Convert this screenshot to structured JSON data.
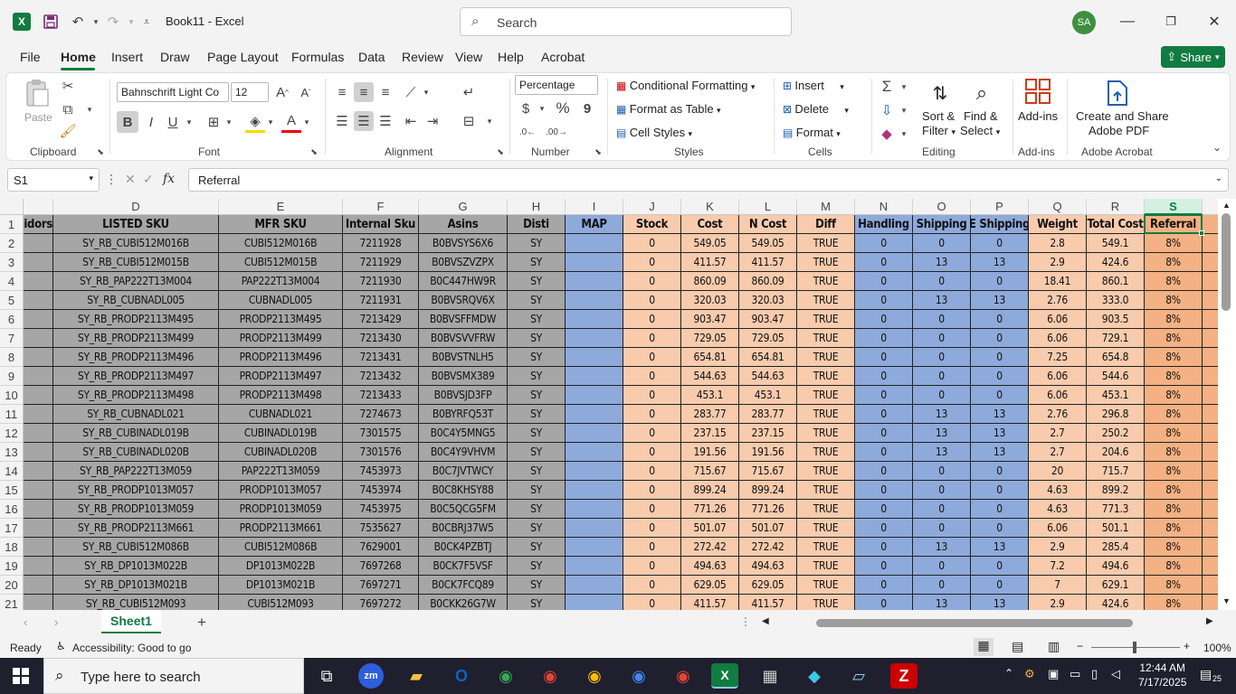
{
  "titlebar": {
    "app_icon": "X",
    "doc_title": "Book11 - Excel",
    "search_placeholder": "Search",
    "user_initials": "SA"
  },
  "tabs": [
    "File",
    "Home",
    "Insert",
    "Draw",
    "Page Layout",
    "Formulas",
    "Data",
    "Review",
    "View",
    "Help",
    "Acrobat"
  ],
  "share_label": "Share",
  "ribbon": {
    "clipboard": {
      "paste": "Paste",
      "label": "Clipboard"
    },
    "font": {
      "name": "Bahnschrift Light Co",
      "size": "12",
      "bold": "B",
      "italic": "I",
      "underline": "U",
      "label": "Font"
    },
    "alignment": {
      "label": "Alignment"
    },
    "number": {
      "format": "Percentage",
      "currency": "$",
      "percent": "%",
      "comma": "9",
      "label": "Number"
    },
    "styles": {
      "cond": "Conditional Formatting",
      "table": "Format as Table",
      "cell": "Cell Styles",
      "label": "Styles"
    },
    "cells": {
      "insert": "Insert",
      "delete": "Delete",
      "format": "Format",
      "label": "Cells"
    },
    "editing": {
      "sort1": "Sort &",
      "sort2": "Filter",
      "find1": "Find &",
      "find2": "Select",
      "label": "Editing"
    },
    "addins": {
      "btn": "Add-ins",
      "label": "Add-ins"
    },
    "acrobat": {
      "btn1": "Create and Share",
      "btn2": "Adobe PDF",
      "label": "Adobe Acrobat"
    }
  },
  "formula_bar": {
    "name_box": "S1",
    "fx": "fx",
    "content": "Referral"
  },
  "columns": [
    {
      "letter": "",
      "header": "idors",
      "color": "gray"
    },
    {
      "letter": "D",
      "header": "LISTED SKU",
      "color": "gray"
    },
    {
      "letter": "E",
      "header": "MFR SKU",
      "color": "gray"
    },
    {
      "letter": "F",
      "header": "Internal Sku",
      "color": "gray"
    },
    {
      "letter": "G",
      "header": "Asins",
      "color": "gray"
    },
    {
      "letter": "H",
      "header": "Disti",
      "color": "gray"
    },
    {
      "letter": "I",
      "header": "MAP",
      "color": "blue"
    },
    {
      "letter": "J",
      "header": "Stock",
      "color": "peach"
    },
    {
      "letter": "K",
      "header": "Cost",
      "color": "peach"
    },
    {
      "letter": "L",
      "header": "N Cost",
      "color": "peach"
    },
    {
      "letter": "M",
      "header": "Diff",
      "color": "peach"
    },
    {
      "letter": "N",
      "header": "Handling",
      "color": "blue"
    },
    {
      "letter": "O",
      "header": "Shipping",
      "color": "blue"
    },
    {
      "letter": "P",
      "header": "E Shipping",
      "color": "blue"
    },
    {
      "letter": "Q",
      "header": "Weight",
      "color": "peach"
    },
    {
      "letter": "R",
      "header": "Total Cost",
      "color": "peach"
    },
    {
      "letter": "S",
      "header": "Referral",
      "color": "orange"
    },
    {
      "letter": "",
      "header": "",
      "color": "orange"
    }
  ],
  "rows": [
    [
      "",
      "SY_RB_CUBI512M016B",
      "CUBI512M016B",
      "7211928",
      "B0BVSYS6X6",
      "SY",
      "",
      "0",
      "549.05",
      "549.05",
      "TRUE",
      "0",
      "0",
      "0",
      "2.8",
      "549.1",
      "8%",
      ""
    ],
    [
      "",
      "SY_RB_CUBI512M015B",
      "CUBI512M015B",
      "7211929",
      "B0BVSZVZPX",
      "SY",
      "",
      "0",
      "411.57",
      "411.57",
      "TRUE",
      "0",
      "13",
      "13",
      "2.9",
      "424.6",
      "8%",
      ""
    ],
    [
      "",
      "SY_RB_PAP222T13M004",
      "PAP222T13M004",
      "7211930",
      "B0C447HW9R",
      "SY",
      "",
      "0",
      "860.09",
      "860.09",
      "TRUE",
      "0",
      "0",
      "0",
      "18.41",
      "860.1",
      "8%",
      ""
    ],
    [
      "",
      "SY_RB_CUBNADL005",
      "CUBNADL005",
      "7211931",
      "B0BVSRQV6X",
      "SY",
      "",
      "0",
      "320.03",
      "320.03",
      "TRUE",
      "0",
      "13",
      "13",
      "2.76",
      "333.0",
      "8%",
      ""
    ],
    [
      "",
      "SY_RB_PRODP2113M495",
      "PRODP2113M495",
      "7213429",
      "B0BVSFFMDW",
      "SY",
      "",
      "0",
      "903.47",
      "903.47",
      "TRUE",
      "0",
      "0",
      "0",
      "6.06",
      "903.5",
      "8%",
      ""
    ],
    [
      "",
      "SY_RB_PRODP2113M499",
      "PRODP2113M499",
      "7213430",
      "B0BVSVVFRW",
      "SY",
      "",
      "0",
      "729.05",
      "729.05",
      "TRUE",
      "0",
      "0",
      "0",
      "6.06",
      "729.1",
      "8%",
      ""
    ],
    [
      "",
      "SY_RB_PRODP2113M496",
      "PRODP2113M496",
      "7213431",
      "B0BVSTNLH5",
      "SY",
      "",
      "0",
      "654.81",
      "654.81",
      "TRUE",
      "0",
      "0",
      "0",
      "7.25",
      "654.8",
      "8%",
      ""
    ],
    [
      "",
      "SY_RB_PRODP2113M497",
      "PRODP2113M497",
      "7213432",
      "B0BVSMX389",
      "SY",
      "",
      "0",
      "544.63",
      "544.63",
      "TRUE",
      "0",
      "0",
      "0",
      "6.06",
      "544.6",
      "8%",
      ""
    ],
    [
      "",
      "SY_RB_PRODP2113M498",
      "PRODP2113M498",
      "7213433",
      "B0BVSJD3FP",
      "SY",
      "",
      "0",
      "453.1",
      "453.1",
      "TRUE",
      "0",
      "0",
      "0",
      "6.06",
      "453.1",
      "8%",
      ""
    ],
    [
      "",
      "SY_RB_CUBNADL021",
      "CUBNADL021",
      "7274673",
      "B0BYRFQ53T",
      "SY",
      "",
      "0",
      "283.77",
      "283.77",
      "TRUE",
      "0",
      "13",
      "13",
      "2.76",
      "296.8",
      "8%",
      ""
    ],
    [
      "",
      "SY_RB_CUBINADL019B",
      "CUBINADL019B",
      "7301575",
      "B0C4Y5MNG5",
      "SY",
      "",
      "0",
      "237.15",
      "237.15",
      "TRUE",
      "0",
      "13",
      "13",
      "2.7",
      "250.2",
      "8%",
      ""
    ],
    [
      "",
      "SY_RB_CUBINADL020B",
      "CUBINADL020B",
      "7301576",
      "B0C4Y9VHVM",
      "SY",
      "",
      "0",
      "191.56",
      "191.56",
      "TRUE",
      "0",
      "13",
      "13",
      "2.7",
      "204.6",
      "8%",
      ""
    ],
    [
      "",
      "SY_RB_PAP222T13M059",
      "PAP222T13M059",
      "7453973",
      "B0C7JVTWCY",
      "SY",
      "",
      "0",
      "715.67",
      "715.67",
      "TRUE",
      "0",
      "0",
      "0",
      "20",
      "715.7",
      "8%",
      ""
    ],
    [
      "",
      "SY_RB_PRODP1013M057",
      "PRODP1013M057",
      "7453974",
      "B0C8KHSY88",
      "SY",
      "",
      "0",
      "899.24",
      "899.24",
      "TRUE",
      "0",
      "0",
      "0",
      "4.63",
      "899.2",
      "8%",
      ""
    ],
    [
      "",
      "SY_RB_PRODP1013M059",
      "PRODP1013M059",
      "7453975",
      "B0C5QCG5FM",
      "SY",
      "",
      "0",
      "771.26",
      "771.26",
      "TRUE",
      "0",
      "0",
      "0",
      "4.63",
      "771.3",
      "8%",
      ""
    ],
    [
      "",
      "SY_RB_PRODP2113M661",
      "PRODP2113M661",
      "7535627",
      "B0CBRJ37W5",
      "SY",
      "",
      "0",
      "501.07",
      "501.07",
      "TRUE",
      "0",
      "0",
      "0",
      "6.06",
      "501.1",
      "8%",
      ""
    ],
    [
      "",
      "SY_RB_CUBI512M086B",
      "CUBI512M086B",
      "7629001",
      "B0CK4PZBTJ",
      "SY",
      "",
      "0",
      "272.42",
      "272.42",
      "TRUE",
      "0",
      "13",
      "13",
      "2.9",
      "285.4",
      "8%",
      ""
    ],
    [
      "",
      "SY_RB_DP1013M022B",
      "DP1013M022B",
      "7697268",
      "B0CK7F5VSF",
      "SY",
      "",
      "0",
      "494.63",
      "494.63",
      "TRUE",
      "0",
      "0",
      "0",
      "7.2",
      "494.6",
      "8%",
      ""
    ],
    [
      "",
      "SY_RB_DP1013M021B",
      "DP1013M021B",
      "7697271",
      "B0CK7FCQ89",
      "SY",
      "",
      "0",
      "629.05",
      "629.05",
      "TRUE",
      "0",
      "0",
      "0",
      "7",
      "629.1",
      "8%",
      ""
    ],
    [
      "",
      "SY_RB_CUBI512M093",
      "CUBI512M093",
      "7697272",
      "B0CKK26G7W",
      "SY",
      "",
      "0",
      "411.57",
      "411.57",
      "TRUE",
      "0",
      "13",
      "13",
      "2.9",
      "424.6",
      "8%",
      ""
    ]
  ],
  "sheet": {
    "name": "Sheet1",
    "add": "+"
  },
  "status": {
    "ready": "Ready",
    "accessibility": "Accessibility: Good to go",
    "zoom": "100%"
  },
  "taskbar": {
    "search": "Type here to search",
    "time": "12:44 AM",
    "date": "7/17/2025",
    "notif": "25"
  },
  "colors": {
    "gray": "#a6a6a6",
    "blue": "#8eaadb",
    "peach": "#f8cbad",
    "orange": "#f4b183",
    "accent": "#107c41"
  }
}
